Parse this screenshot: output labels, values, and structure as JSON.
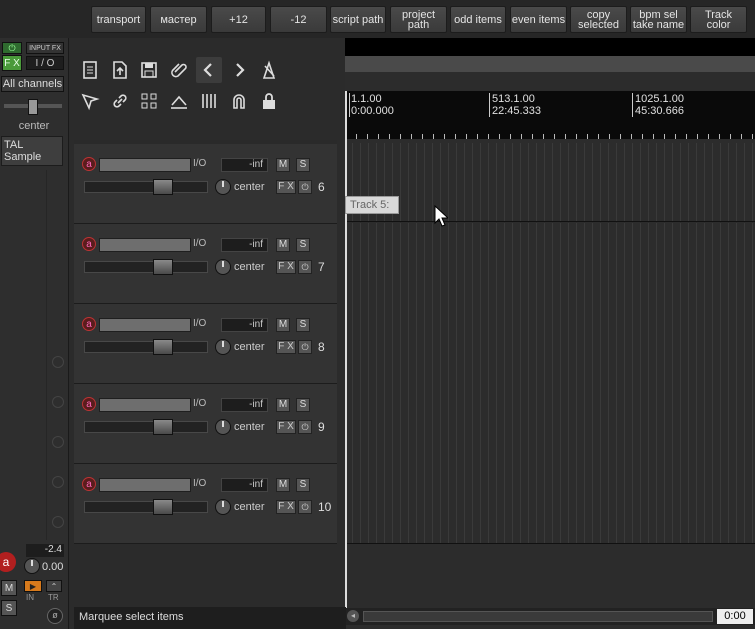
{
  "toolbar": {
    "buttons": [
      "transport",
      "мастер",
      "+12",
      "-12",
      "script path",
      "project\npath",
      "odd items",
      "even items",
      "copy\nselected",
      "bpm sel\ntake name",
      "Track\ncolor"
    ]
  },
  "master": {
    "fx_label": "F X",
    "input_fx_label": "INPUT FX",
    "io_label": "I / O",
    "channels_label": "All channels",
    "pan_label": "center",
    "plugin_label": "TAL Sample",
    "volume_db": "-2.4",
    "pan_value": "0.00",
    "m_label": "M",
    "s_label": "S",
    "in_label": "IN",
    "tr_label": "TR"
  },
  "tracks": [
    {
      "num": "6",
      "io": "I/O",
      "meter": "-inf",
      "pan": "center",
      "fx": "F X",
      "m": "M",
      "s": "S"
    },
    {
      "num": "7",
      "io": "I/O",
      "meter": "-inf",
      "pan": "center",
      "fx": "F X",
      "m": "M",
      "s": "S"
    },
    {
      "num": "8",
      "io": "I/O",
      "meter": "-inf",
      "pan": "center",
      "fx": "F X",
      "m": "M",
      "s": "S"
    },
    {
      "num": "9",
      "io": "I/O",
      "meter": "-inf",
      "pan": "center",
      "fx": "F X",
      "m": "M",
      "s": "S"
    },
    {
      "num": "10",
      "io": "I/O",
      "meter": "-inf",
      "pan": "center",
      "fx": "F X",
      "m": "M",
      "s": "S"
    }
  ],
  "ruler": {
    "markers": [
      {
        "bar": "1.1.00",
        "time": "0:00.000"
      },
      {
        "bar": "513.1.00",
        "time": "22:45.333"
      },
      {
        "bar": "1025.1.00",
        "time": "45:30.666"
      }
    ]
  },
  "tooltip": "Track 5:",
  "status": "Marquee select items",
  "zoom_label": "0:00"
}
